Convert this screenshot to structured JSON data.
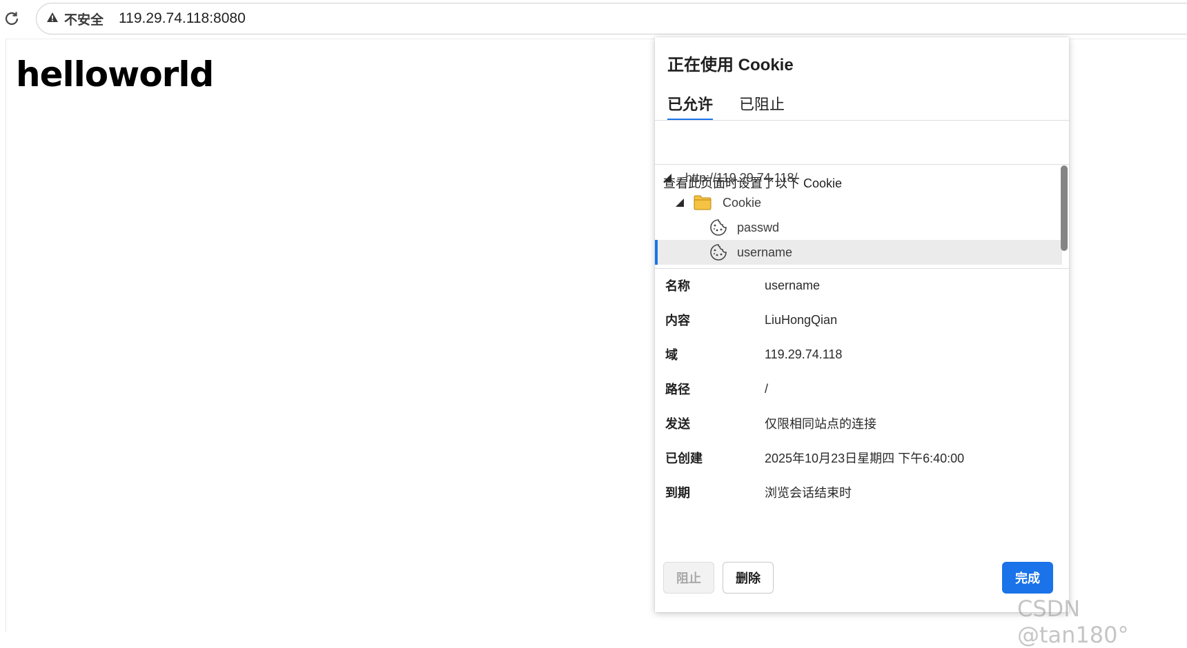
{
  "browser": {
    "security_label": "不安全",
    "url": "119.29.74.118:8080"
  },
  "page": {
    "heading": "helloworld"
  },
  "cookie_dialog": {
    "title": "正在使用 Cookie",
    "tabs": [
      {
        "label": "已允许",
        "active": true
      },
      {
        "label": "已阻止",
        "active": false
      }
    ],
    "description": "查看此页面时设置了以下 Cookie",
    "tree": {
      "site": "http://119.29.74.118/",
      "folder": "Cookie",
      "cookies": [
        "passwd",
        "username"
      ],
      "selected": "username"
    },
    "details": [
      {
        "label": "名称",
        "value": "username"
      },
      {
        "label": "内容",
        "value": "LiuHongQian"
      },
      {
        "label": "域",
        "value": "119.29.74.118"
      },
      {
        "label": "路径",
        "value": "/"
      },
      {
        "label": "发送",
        "value": "仅限相同站点的连接"
      },
      {
        "label": "已创建",
        "value": "2025年10月23日星期四 下午6:40:00"
      },
      {
        "label": "到期",
        "value": "浏览会话结束时"
      }
    ],
    "buttons": {
      "block": "阻止",
      "delete": "删除",
      "done": "完成"
    }
  },
  "watermark": "CSDN @tan180°",
  "colors": {
    "accent": "#1a73e8",
    "folder": "#f5c244",
    "selected_row": "#ebebeb"
  }
}
